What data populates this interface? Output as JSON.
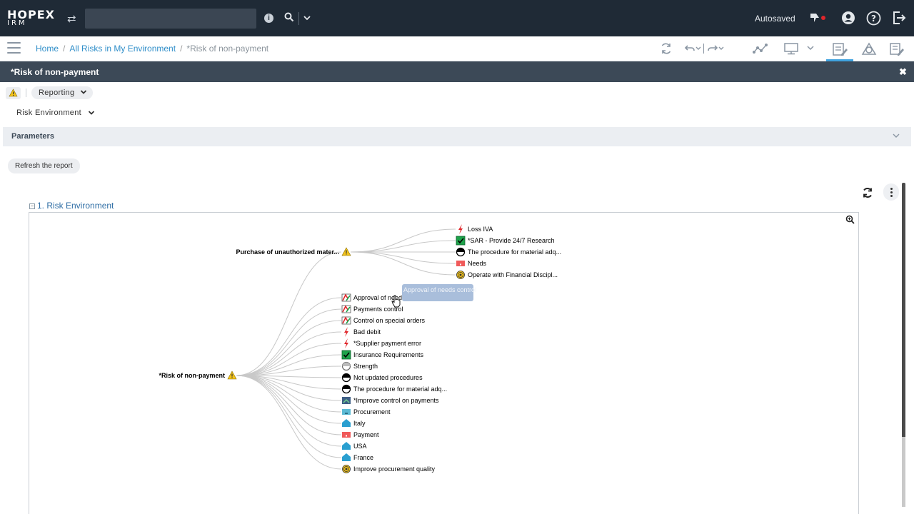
{
  "header": {
    "logo_line1": "HOPEX",
    "logo_line2": "IRM",
    "search_value": "",
    "autosaved": "Autosaved"
  },
  "breadcrumb": {
    "home": "Home",
    "parent": "All Risks in My Environment",
    "current": "*Risk of non-payment"
  },
  "panel": {
    "title": "*Risk of non-payment",
    "reporting_label": "Reporting",
    "report_selector": "Risk Environment",
    "parameters_label": "Parameters",
    "refresh_label": "Refresh the report"
  },
  "report": {
    "section_toggle": "−",
    "section_title": "1. Risk Environment",
    "root": {
      "label": "*Risk of non-payment",
      "icon": "warning-icon"
    },
    "sub_root": {
      "label": "Purchase of unauthorized mater...",
      "icon": "warning-icon"
    },
    "sub_children": [
      {
        "label": "Loss IVA",
        "icon": "lightning-icon"
      },
      {
        "label": "*SAR - Provide 24/7 Research",
        "icon": "checkbox-icon"
      },
      {
        "label": "The procedure for material adq...",
        "icon": "half-circle-icon"
      },
      {
        "label": "Needs",
        "icon": "need-icon"
      },
      {
        "label": "Operate with Financial Discipl...",
        "icon": "target-icon"
      }
    ],
    "root_children": [
      {
        "label": "Approval of needs control",
        "icon": "control-icon"
      },
      {
        "label": "Payments control",
        "icon": "control-icon"
      },
      {
        "label": "Control on special orders",
        "icon": "control-icon"
      },
      {
        "label": "Bad debit",
        "icon": "lightning-icon"
      },
      {
        "label": "*Supplier payment error",
        "icon": "lightning-icon"
      },
      {
        "label": "Insurance Requirements",
        "icon": "checkbox-icon"
      },
      {
        "label": "Strength",
        "icon": "half-circle-light-icon"
      },
      {
        "label": "Not updated procedures",
        "icon": "half-circle-icon"
      },
      {
        "label": "The procedure for material adq...",
        "icon": "half-circle-icon"
      },
      {
        "label": "*Improve control on payments",
        "icon": "action-plan-icon"
      },
      {
        "label": "Procurement",
        "icon": "process-icon"
      },
      {
        "label": "Italy",
        "icon": "site-icon"
      },
      {
        "label": "Payment",
        "icon": "need-icon"
      },
      {
        "label": "USA",
        "icon": "site-icon"
      },
      {
        "label": "France",
        "icon": "site-icon"
      },
      {
        "label": "Improve procurement quality",
        "icon": "target-icon"
      }
    ],
    "tooltip": "Approval of needs control"
  },
  "colors": {
    "topbar": "#1f2a36",
    "titlebar": "#3c4957",
    "link": "#2f8ec9",
    "warning": "#f2c31b",
    "accent": "#3fa2de"
  }
}
